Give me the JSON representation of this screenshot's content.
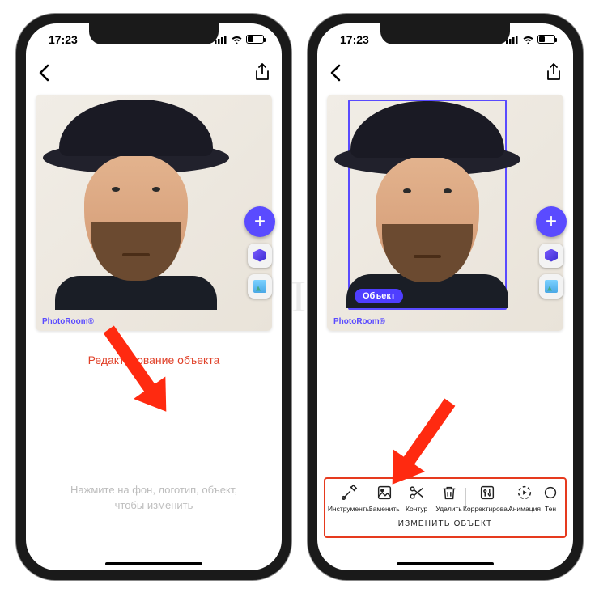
{
  "status": {
    "time": "17:23"
  },
  "canvas": {
    "brand": "PhotoRoom®",
    "object_label": "Объект"
  },
  "left": {
    "caption": "Редактирование объекта",
    "hint_line1": "Нажмите на фон, логотип, объект,",
    "hint_line2": "чтобы изменить"
  },
  "right": {
    "section_title": "ИЗМЕНИТЬ ОБЪЕКТ",
    "tools": {
      "t0": "Инструменты",
      "t1": "Заменить",
      "t2": "Контур",
      "t3": "Удалить",
      "t4": "Корректирова..",
      "t5": "Анимация",
      "t6": "Тен"
    }
  },
  "watermark": "ЯБЛЫК"
}
